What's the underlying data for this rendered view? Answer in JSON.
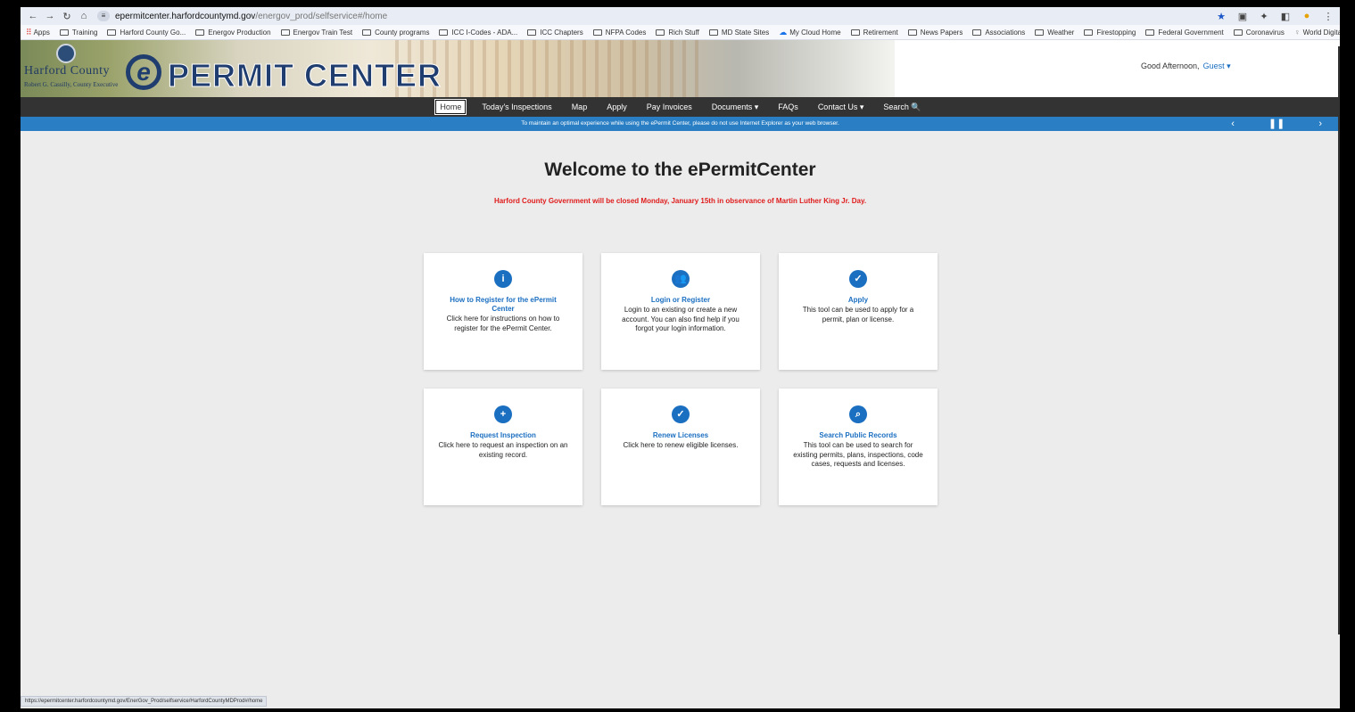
{
  "browser": {
    "url_host": "epermitcenter.harfordcountymd.gov",
    "url_path": "/energov_prod/selfservice#/home",
    "bookmarks": [
      "Apps",
      "Training",
      "Harford County Go...",
      "Energov Production",
      "Energov Train Test",
      "County programs",
      "ICC I-Codes - ADA...",
      "ICC Chapters",
      "NFPA Codes",
      "Rich Stuff",
      "MD State Sites",
      "My Cloud Home",
      "Retirement",
      "News Papers",
      "Associations",
      "Weather",
      "Firestopping",
      "Federal Government",
      "Coronavirus",
      "World Digital Librar..."
    ],
    "bookmarks_more": "»",
    "status_url": "https://epermitcenter.harfordcountymd.gov/EnerGov_Prod/selfservice/HarfordCountyMDProd#/home"
  },
  "header": {
    "county_name": "Harford County",
    "county_exec": "Robert G. Cassilly, County Executive",
    "logo_letter": "e",
    "logo_title": "PERMIT CENTER",
    "greeting": "Good Afternoon,",
    "user": "Guest ▾"
  },
  "nav": {
    "items": [
      "Home",
      "Today's Inspections",
      "Map",
      "Apply",
      "Pay Invoices",
      "Documents ▾",
      "FAQs",
      "Contact Us ▾",
      "Search 🔍"
    ]
  },
  "notice": {
    "text": "To maintain an optimal experience while using the ePermit Center, please do not use Internet Explorer as your web browser."
  },
  "main": {
    "welcome": "Welcome to the ePermitCenter",
    "closing": "Harford County Government will be closed Monday, January 15th in observance of Martin Luther King Jr. Day.",
    "cards": [
      {
        "icon": "info-icon",
        "glyph": "i",
        "title": "How to Register for the ePermit Center",
        "desc": "Click here for instructions on how to register for the ePermit Center."
      },
      {
        "icon": "users-icon",
        "glyph": "👥",
        "title": "Login or Register",
        "desc": "Login to an existing or create a new account. You can also find help if you forgot your login information."
      },
      {
        "icon": "clipboard-check-icon",
        "glyph": "✓",
        "title": "Apply",
        "desc": "This tool can be used to apply for a permit, plan or license."
      },
      {
        "icon": "calendar-plus-icon",
        "glyph": "+",
        "title": "Request Inspection",
        "desc": "Click here to request an inspection on an existing record."
      },
      {
        "icon": "clipboard-check-icon",
        "glyph": "✓",
        "title": "Renew Licenses",
        "desc": "Click here to renew eligible licenses."
      },
      {
        "icon": "search-icon",
        "glyph": "⌕",
        "title": "Search Public Records",
        "desc": "This tool can be used to search for existing permits, plans, inspections, code cases, requests and licenses."
      }
    ]
  },
  "colors": {
    "nav_bg": "#333333",
    "notice_bg": "#2a7fc4",
    "accent": "#1b6fc1",
    "alert": "#e01b1b",
    "page_bg": "#ececec"
  }
}
